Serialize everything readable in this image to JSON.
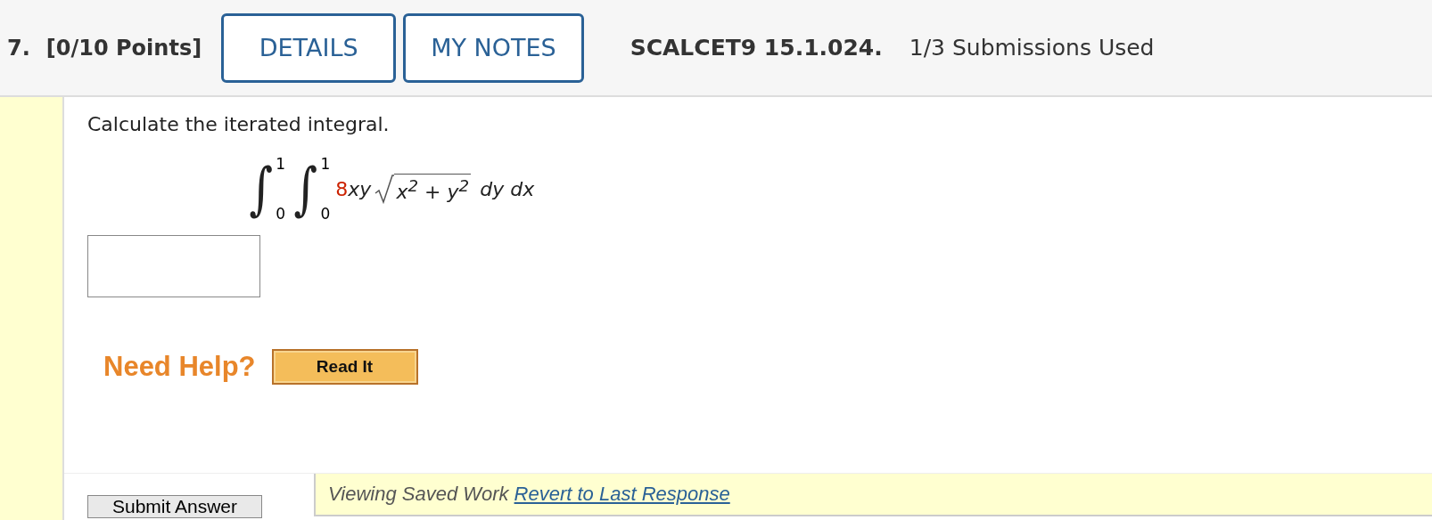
{
  "question": {
    "number": "7.",
    "points": "[0/10 Points]",
    "buttons": [
      "DETAILS",
      "MY NOTES"
    ],
    "code": "SCALCET9 15.1.024.",
    "submissions": "1/3 Submissions Used"
  },
  "prompt": "Calculate the iterated integral.",
  "formula": {
    "integrals": [
      {
        "sign": "∫",
        "upper": "1",
        "lower": "0"
      },
      {
        "sign": "∫",
        "upper": "1",
        "lower": "0"
      }
    ],
    "coefficient": "8",
    "variables": "xy",
    "radicand": "x$^{2}$ + y$^{2}$",
    "differentials": "dy dx"
  },
  "help": {
    "label": "Need Help?",
    "button": "Read It"
  },
  "submit": "Submit Answer",
  "saved_notice": {
    "text": "Viewing Saved Work",
    "link": "Revert to Last Response"
  }
}
